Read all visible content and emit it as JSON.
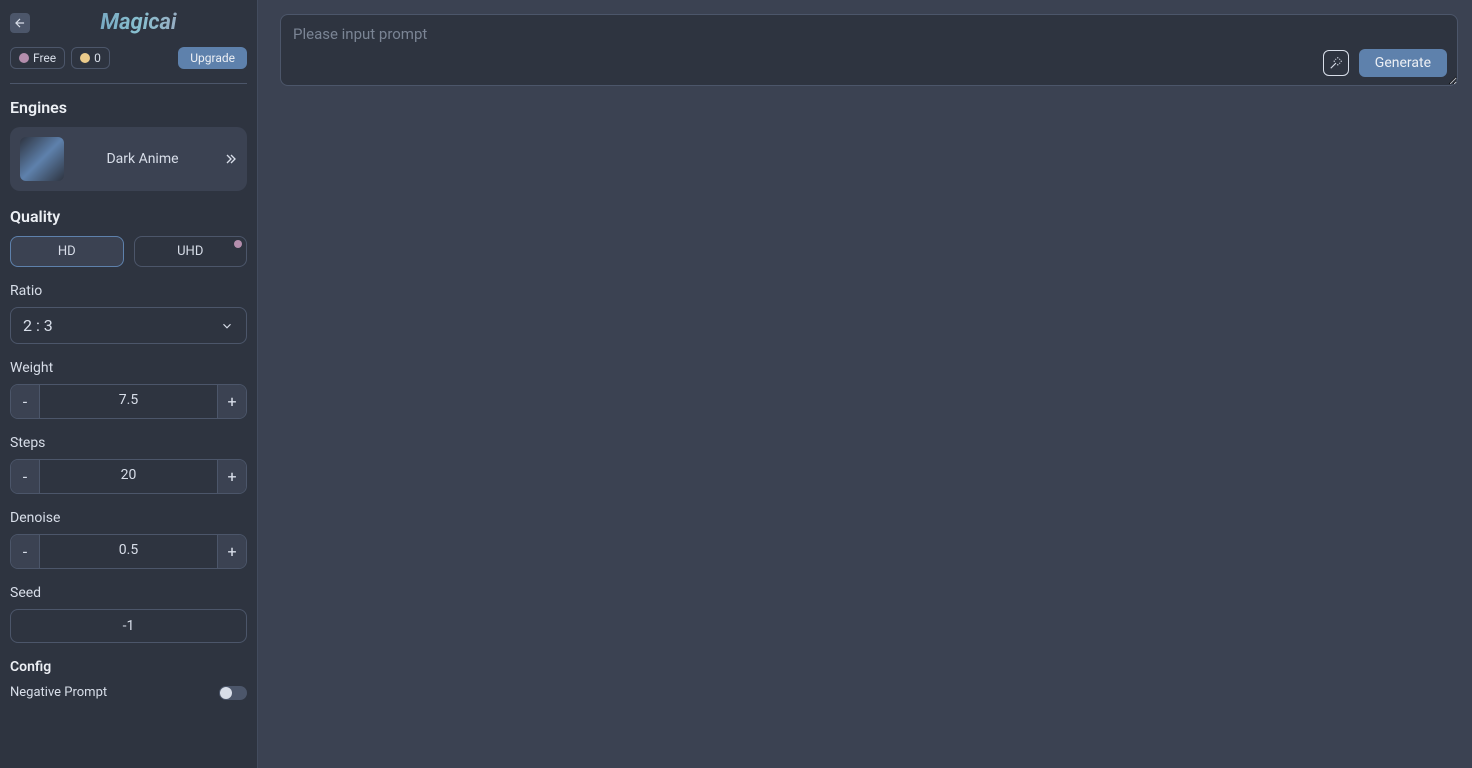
{
  "header": {
    "logo": "Magicai",
    "plan_label": "Free",
    "credits": "0",
    "upgrade_label": "Upgrade"
  },
  "engines": {
    "title": "Engines",
    "selected_name": "Dark Anime"
  },
  "quality": {
    "title": "Quality",
    "hd_label": "HD",
    "uhd_label": "UHD"
  },
  "ratio": {
    "title": "Ratio",
    "value": "2 : 3"
  },
  "weight": {
    "title": "Weight",
    "value": "7.5",
    "minus": "-",
    "plus": "+"
  },
  "steps": {
    "title": "Steps",
    "value": "20",
    "minus": "-",
    "plus": "+"
  },
  "denoise": {
    "title": "Denoise",
    "value": "0.5",
    "minus": "-",
    "plus": "+"
  },
  "seed": {
    "title": "Seed",
    "value": "-1"
  },
  "config": {
    "title": "Config",
    "negative_prompt_label": "Negative Prompt"
  },
  "prompt": {
    "placeholder": "Please input prompt",
    "generate_label": "Generate"
  }
}
